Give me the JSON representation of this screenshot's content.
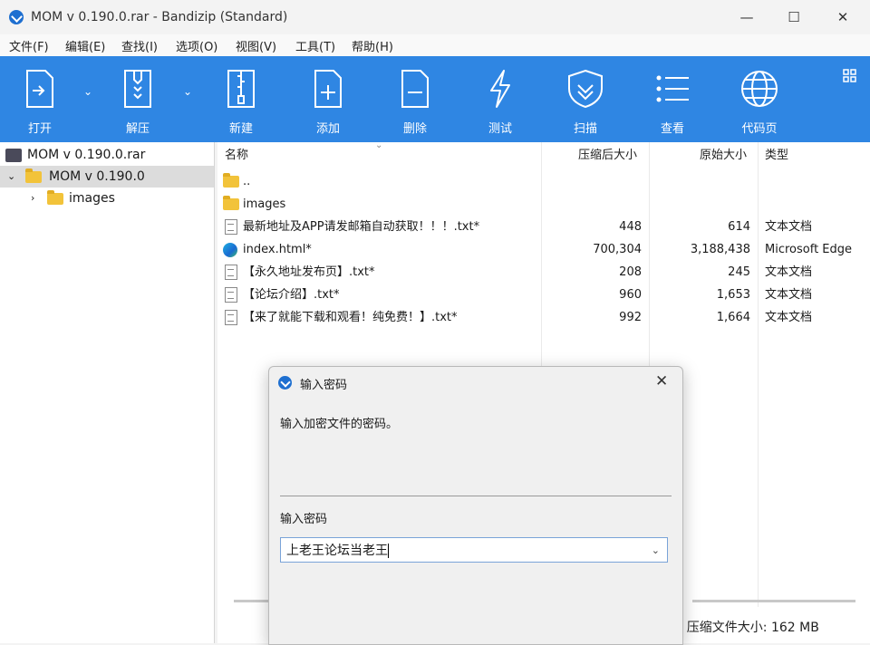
{
  "window": {
    "title": "MOM v 0.190.0.rar - Bandizip (Standard)",
    "minimize": "—",
    "maximize": "☐",
    "close": "✕"
  },
  "menu": [
    "文件(F)",
    "编辑(E)",
    "查找(I)",
    "选项(O)",
    "视图(V)",
    "工具(T)",
    "帮助(H)"
  ],
  "toolbar": {
    "open": "打开",
    "extract": "解压",
    "new": "新建",
    "add": "添加",
    "delete": "删除",
    "test": "测试",
    "scan": "扫描",
    "view": "查看",
    "codepage": "代码页"
  },
  "tree": {
    "archive": "MOM v 0.190.0.rar",
    "root_folder": "MOM v 0.190.0",
    "child_folder": "images"
  },
  "columns": {
    "name": "名称",
    "packed": "压缩后大小",
    "original": "原始大小",
    "type": "类型"
  },
  "files": [
    {
      "name": "..",
      "packed": "",
      "original": "",
      "type": "",
      "icon": "folder-icon"
    },
    {
      "name": "images",
      "packed": "",
      "original": "",
      "type": "",
      "icon": "folder-icon"
    },
    {
      "name": "最新地址及APP请发邮箱自动获取！！！.txt*",
      "packed": "448",
      "original": "614",
      "type": "文本文档",
      "icon": "text-file-icon"
    },
    {
      "name": "index.html*",
      "packed": "700,304",
      "original": "3,188,438",
      "type": "Microsoft Edge",
      "icon": "edge-icon"
    },
    {
      "name": "【永久地址发布页】.txt*",
      "packed": "208",
      "original": "245",
      "type": "文本文档",
      "icon": "text-file-icon"
    },
    {
      "name": "【论坛介绍】.txt*",
      "packed": "960",
      "original": "1,653",
      "type": "文本文档",
      "icon": "text-file-icon"
    },
    {
      "name": "【来了就能下载和观看！纯免费！】.txt*",
      "packed": "992",
      "original": "1,664",
      "type": "文本文档",
      "icon": "text-file-icon"
    }
  ],
  "status": "5, 压缩文件大小: 162 MB",
  "dialog": {
    "title": "输入密码",
    "message": "输入加密文件的密码。",
    "field_label": "输入密码",
    "password_value": "上老王论坛当老王",
    "close": "✕"
  },
  "colors": {
    "toolbar_bg": "#2f86e3",
    "accent": "#1e6fd0"
  }
}
